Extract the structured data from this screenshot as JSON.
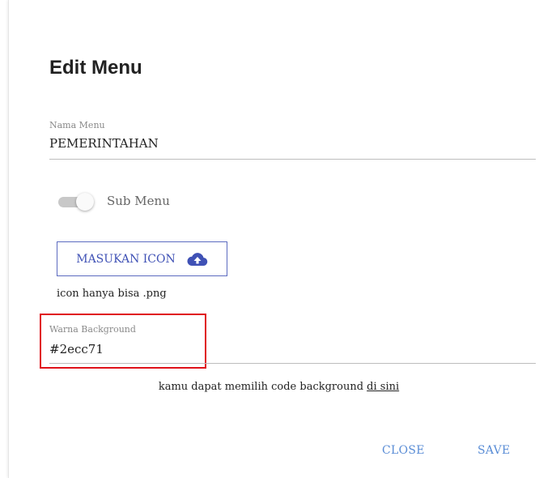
{
  "dialog": {
    "title": "Edit Menu",
    "nama_menu": {
      "label": "Nama Menu",
      "value": "PEMERINTAHAN"
    },
    "sub_menu": {
      "label": "Sub Menu",
      "enabled": false
    },
    "icon_button": {
      "label": "MASUKAN ICON",
      "icon": "cloud-upload-icon"
    },
    "icon_hint": "icon hanya bisa .png",
    "warna_background": {
      "label": "Warna Background",
      "value": "#2ecc71"
    },
    "help_text": "kamu dapat memilih code background",
    "help_link": "di sini",
    "actions": {
      "close": "CLOSE",
      "save": "SAVE"
    }
  },
  "colors": {
    "accent": "#3f51b5",
    "action_text": "#5a8dd6",
    "highlight_box": "#e0121a"
  }
}
